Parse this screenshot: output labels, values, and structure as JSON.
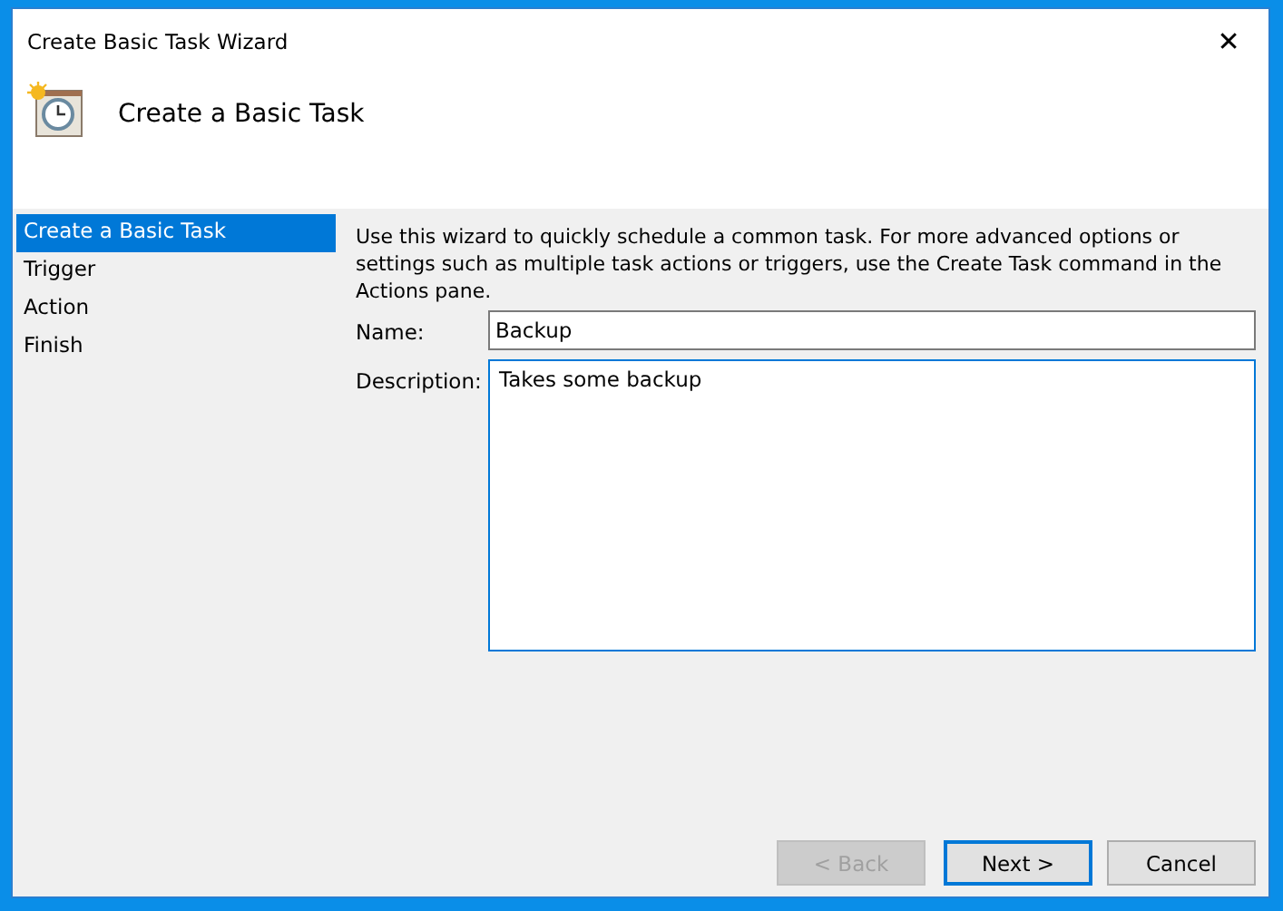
{
  "window": {
    "title": "Create Basic Task Wizard",
    "close": "✕"
  },
  "header": {
    "title": "Create a Basic Task"
  },
  "steps": [
    {
      "label": "Create a Basic Task",
      "selected": true
    },
    {
      "label": "Trigger",
      "selected": false
    },
    {
      "label": "Action",
      "selected": false
    },
    {
      "label": "Finish",
      "selected": false
    }
  ],
  "intro": "Use this wizard to quickly schedule a common task.  For more advanced options or settings such as multiple task actions or triggers, use the Create Task command in the Actions pane.",
  "fields": [
    {
      "label": "Name:",
      "value": "Backup",
      "kind": "line",
      "focused": false
    },
    {
      "label": "Description:",
      "value": "Takes some backup",
      "kind": "multiline",
      "focused": true
    }
  ],
  "buttons": [
    {
      "label": "< Back",
      "disabled": true,
      "default": false
    },
    {
      "label": "Next >",
      "disabled": false,
      "default": true
    },
    {
      "label": "Cancel",
      "disabled": false,
      "default": false
    }
  ]
}
